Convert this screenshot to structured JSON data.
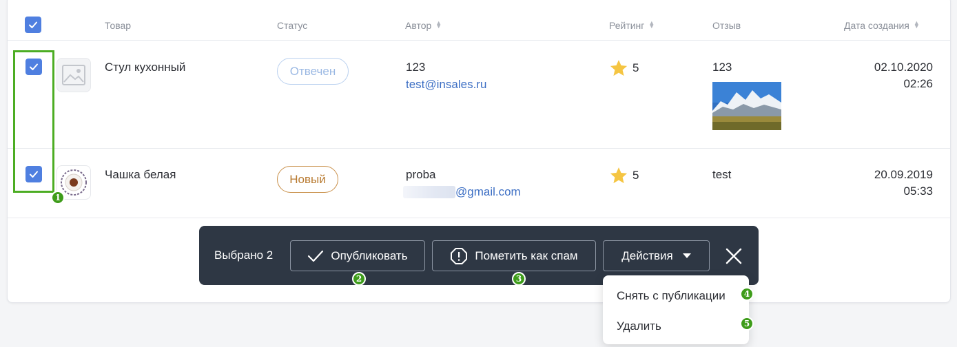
{
  "table": {
    "columns": {
      "product": "Товар",
      "status": "Статус",
      "author": "Автор",
      "rating": "Рейтинг",
      "review": "Отзыв",
      "date": "Дата создания"
    },
    "rows": [
      {
        "selected": true,
        "product": "Стул кухонный",
        "status": "Отвечен",
        "author_name": "123",
        "author_email": "test@insales.ru",
        "rating": "5",
        "review": "123",
        "date": "02.10.2020",
        "time": "02:26"
      },
      {
        "selected": true,
        "product": "Чашка белая",
        "status": "Новый",
        "author_name": "proba",
        "author_email": "@gmail.com",
        "rating": "5",
        "review": "test",
        "date": "20.09.2019",
        "time": "05:33"
      }
    ]
  },
  "action_bar": {
    "selected_text": "Выбрано 2",
    "publish_label": "Опубликовать",
    "spam_label": "Пометить как спам",
    "actions_label": "Действия"
  },
  "actions_menu": {
    "items": [
      "Снять с публикации",
      "Удалить"
    ]
  },
  "annotations": [
    "1",
    "2",
    "3",
    "4",
    "5"
  ],
  "colors": {
    "accent": "#4f7fe0",
    "link": "#3d6fc4",
    "annotation": "#3e9c1a",
    "bar_bg": "#2e3744",
    "status_answered": "#9ab8e3",
    "status_new": "#b87a30",
    "star": "#f5c542"
  }
}
